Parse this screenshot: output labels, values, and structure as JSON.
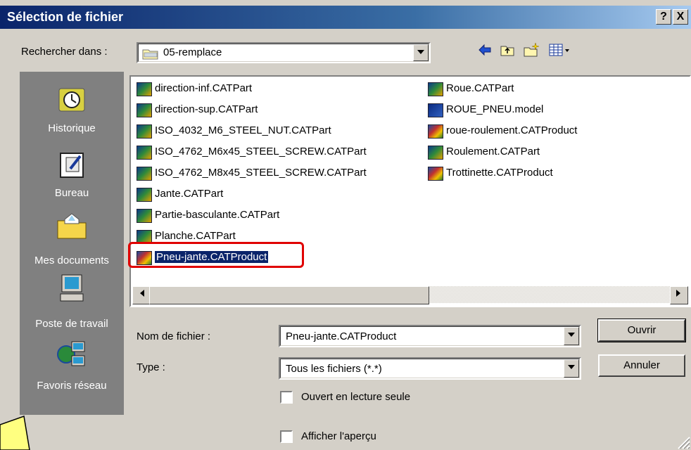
{
  "window": {
    "title": "Sélection de fichier",
    "help_label": "?",
    "close_label": "X"
  },
  "lookin": {
    "label": "Rechercher dans :",
    "value": "05-remplace"
  },
  "toolbar": {
    "back_icon": "back-arrow-icon",
    "up_icon": "up-folder-icon",
    "new_folder_icon": "new-folder-icon",
    "view_icon": "view-menu-icon"
  },
  "places": [
    {
      "label": "Historique",
      "icon": "history-icon"
    },
    {
      "label": "Bureau",
      "icon": "desktop-icon"
    },
    {
      "label": "Mes documents",
      "icon": "my-documents-icon"
    },
    {
      "label": "Poste de travail",
      "icon": "my-computer-icon"
    },
    {
      "label": "Favoris réseau",
      "icon": "network-places-icon"
    }
  ],
  "files": {
    "col1": [
      {
        "name": "direction-inf.CATPart",
        "kind": "part"
      },
      {
        "name": "direction-sup.CATPart",
        "kind": "part"
      },
      {
        "name": "ISO_4032_M6_STEEL_NUT.CATPart",
        "kind": "part"
      },
      {
        "name": "ISO_4762_M6x45_STEEL_SCREW.CATPart",
        "kind": "part"
      },
      {
        "name": "ISO_4762_M8x45_STEEL_SCREW.CATPart",
        "kind": "part"
      },
      {
        "name": "Jante.CATPart",
        "kind": "part"
      },
      {
        "name": "Partie-basculante.CATPart",
        "kind": "part"
      },
      {
        "name": "Planche.CATPart",
        "kind": "part"
      },
      {
        "name": "Pneu-jante.CATProduct",
        "kind": "product",
        "selected": true
      }
    ],
    "col2": [
      {
        "name": "Roue.CATPart",
        "kind": "part"
      },
      {
        "name": "ROUE_PNEU.model",
        "kind": "model"
      },
      {
        "name": "roue-roulement.CATProduct",
        "kind": "product"
      },
      {
        "name": "Roulement.CATPart",
        "kind": "part"
      },
      {
        "name": "Trottinette.CATProduct",
        "kind": "product"
      }
    ]
  },
  "filename": {
    "label": "Nom de fichier :",
    "value": "Pneu-jante.CATProduct"
  },
  "filetype": {
    "label": "Type :",
    "value": "Tous les fichiers (*.*)"
  },
  "readonly": {
    "label": "Ouvert en lecture seule",
    "checked": false
  },
  "preview": {
    "label": "Afficher l'aperçu",
    "checked": false
  },
  "buttons": {
    "open": "Ouvrir",
    "cancel": "Annuler"
  },
  "colors": {
    "selection_highlight": "#e00000",
    "title_bar": "#0a246a",
    "places_bg": "#808080"
  }
}
